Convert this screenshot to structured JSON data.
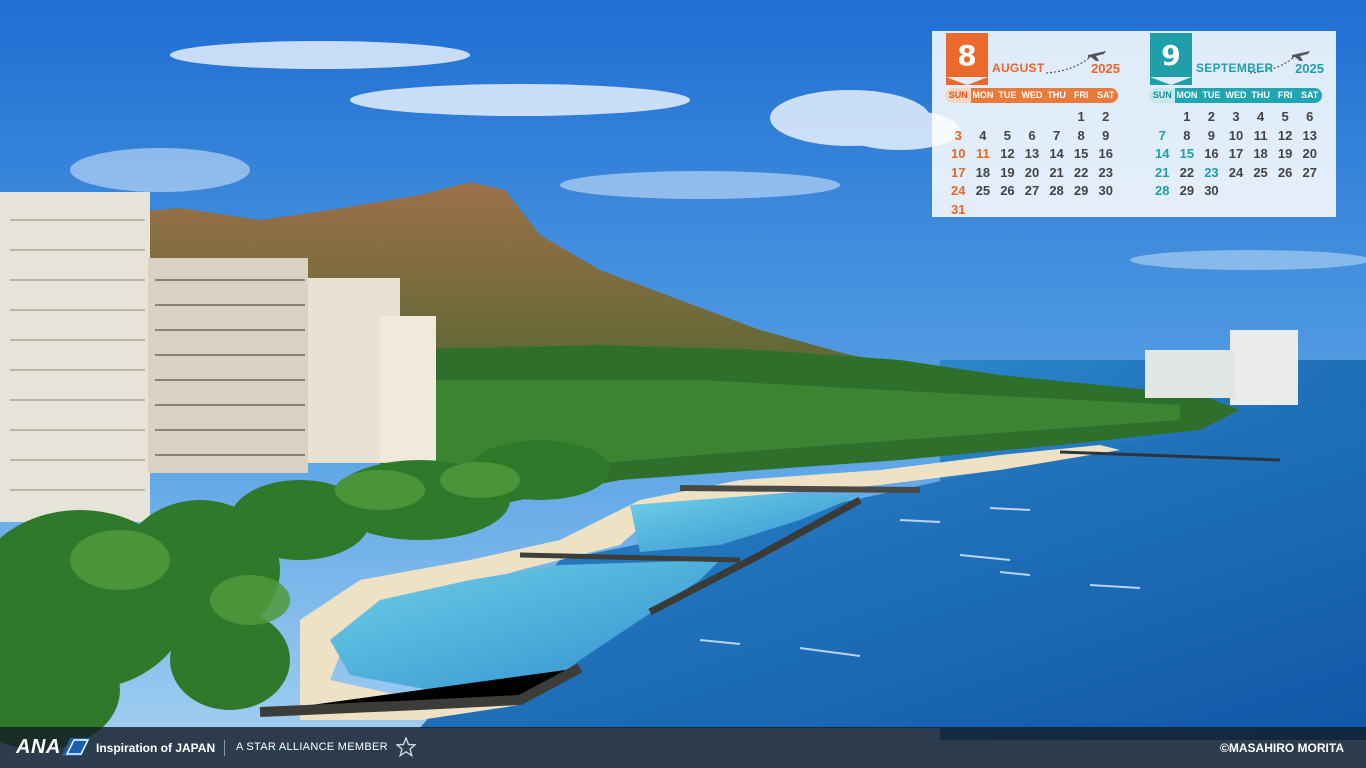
{
  "scene": {
    "icon": "waikiki-diamond-head-photo",
    "colors": {
      "sky_top": "#1f74d6",
      "sky_bottom": "#8ec5ee",
      "ocean": "#1e6bb8",
      "lagoon": "#55b7de",
      "sand": "#efe2c4",
      "mountain": "#8b6a45",
      "forest": "#2d6b2a"
    }
  },
  "calendar": {
    "august": {
      "number": "8",
      "name": "AUGUST",
      "year": "2025",
      "days_of_week": [
        "SUN",
        "MON",
        "TUE",
        "WED",
        "THU",
        "FRI",
        "SAT"
      ],
      "cells": [
        "",
        "",
        "",
        "",
        "",
        "1",
        "2",
        "3",
        "4",
        "5",
        "6",
        "7",
        "8",
        "9",
        "10",
        "11",
        "12",
        "13",
        "14",
        "15",
        "16",
        "17",
        "18",
        "19",
        "20",
        "21",
        "22",
        "23",
        "24",
        "25",
        "26",
        "27",
        "28",
        "29",
        "30",
        "31",
        "",
        "",
        "",
        "",
        "",
        ""
      ],
      "highlight": [
        "3",
        "10",
        "11",
        "17",
        "24",
        "31"
      ],
      "accent": "#ea6a2b"
    },
    "september": {
      "number": "9",
      "name": "SEPTEMBER",
      "year": "2025",
      "days_of_week": [
        "SUN",
        "MON",
        "TUE",
        "WED",
        "THU",
        "FRI",
        "SAT"
      ],
      "cells": [
        "",
        "1",
        "2",
        "3",
        "4",
        "5",
        "6",
        "7",
        "8",
        "9",
        "10",
        "11",
        "12",
        "13",
        "14",
        "15",
        "16",
        "17",
        "18",
        "19",
        "20",
        "21",
        "22",
        "23",
        "24",
        "25",
        "26",
        "27",
        "28",
        "29",
        "30",
        "",
        "",
        "",
        ""
      ],
      "highlight": [
        "7",
        "14",
        "15",
        "21",
        "23",
        "28"
      ],
      "accent": "#1e9faa"
    }
  },
  "footer": {
    "brand": "ANA",
    "tagline": "Inspiration of JAPAN",
    "alliance": "A STAR ALLIANCE MEMBER",
    "credit": "©MASAHIRO MORITA"
  }
}
